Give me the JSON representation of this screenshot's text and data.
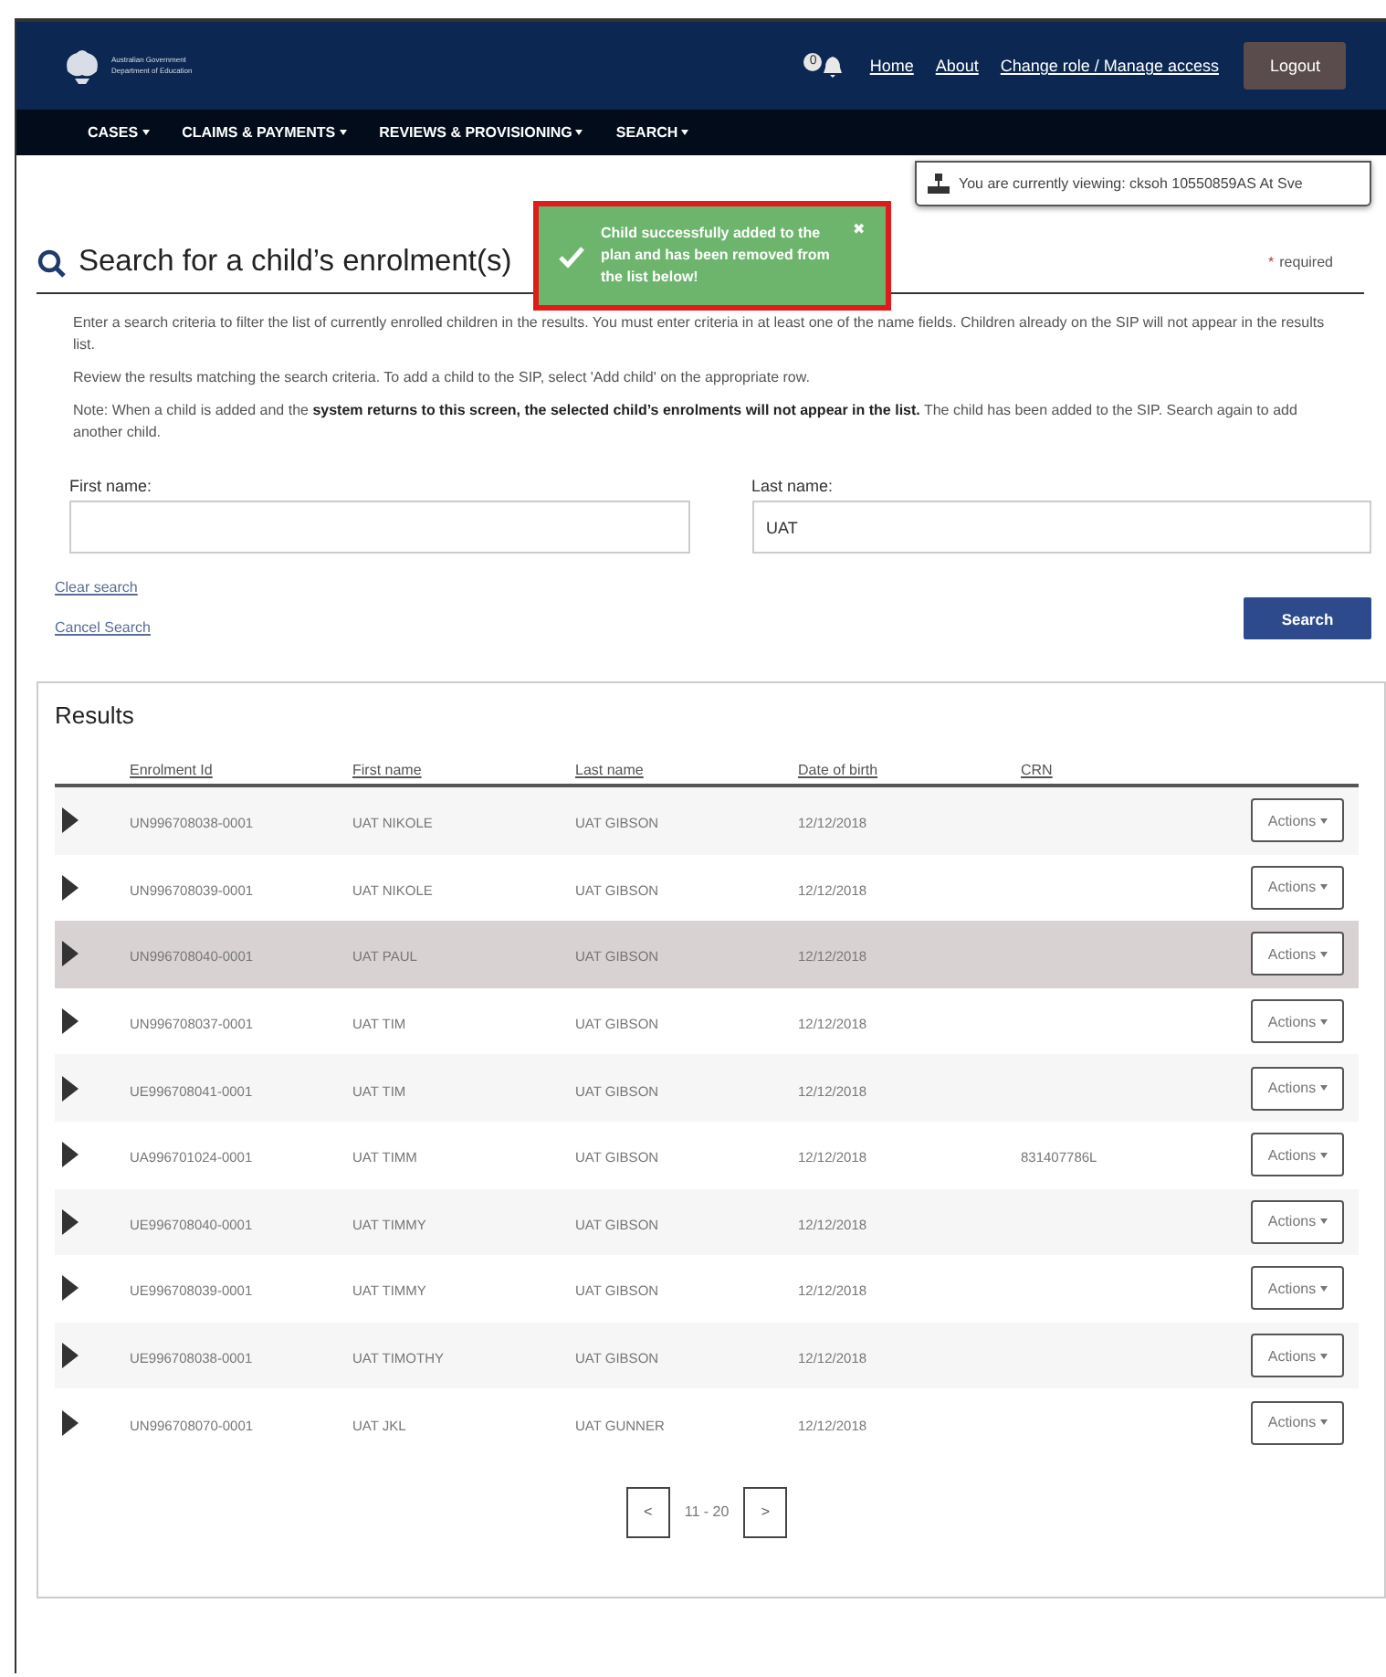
{
  "header": {
    "logo_lines": [
      "Australian Government",
      "Department of Education"
    ],
    "notification_count": "0",
    "links": [
      "Home",
      "About",
      "Change role / Manage access"
    ],
    "logout": "Logout"
  },
  "nav": {
    "items": [
      "CASES",
      "CLAIMS & PAYMENTS",
      "REVIEWS & PROVISIONING",
      "SEARCH"
    ]
  },
  "viewing_notice": "You are currently viewing: cksoh 10550859AS At Sve",
  "toast": {
    "message": "Child successfully added to the plan and has been removed from the list below!",
    "close": "✖"
  },
  "page": {
    "title": "Search for a child’s enrolment(s)",
    "required_mark": "*",
    "required_label": "required",
    "instructions": [
      "Enter a search criteria to filter the list of currently enrolled children in the results. You must enter criteria in at least one of the name fields. Children already on the SIP will not appear in the results list.",
      "Review the results matching the search criteria. To add a child to the SIP, select 'Add child' on the appropriate row.",
      "Note: When a child is added and the **system returns to this screen, the selected child’s enrolments will not appear in the list.** The child has been added to the SIP. Search again to add another child."
    ]
  },
  "form": {
    "fields": [
      {
        "label": "First name:"
      },
      {
        "label": "Last name:",
        "value": "UAT"
      }
    ],
    "clear_search": "Clear search",
    "cancel_search": "Cancel Search",
    "search_button": "Search"
  },
  "results": {
    "title": "Results",
    "columns": [
      "Enrolment Id",
      "First name",
      "Last name",
      "Date of birth",
      "CRN"
    ],
    "rows": [
      {
        "enrolment_id": "UN996708038-0001",
        "first_name": "UAT NIKOLE",
        "last_name": "UAT GIBSON",
        "date_of_birth": "12/12/2018",
        "selected": false,
        "action": "Actions"
      },
      {
        "enrolment_id": "UN996708039-0001",
        "first_name": "UAT NIKOLE",
        "last_name": "UAT GIBSON",
        "date_of_birth": "12/12/2018",
        "selected": false,
        "action": "Actions"
      },
      {
        "enrolment_id": "UN996708040-0001",
        "first_name": "UAT PAUL",
        "last_name": "UAT GIBSON",
        "date_of_birth": "12/12/2018",
        "selected": true,
        "action": "Actions"
      },
      {
        "enrolment_id": "UN996708037-0001",
        "first_name": "UAT TIM",
        "last_name": "UAT GIBSON",
        "date_of_birth": "12/12/2018",
        "selected": false,
        "action": "Actions"
      },
      {
        "enrolment_id": "UE996708041-0001",
        "first_name": "UAT TIM",
        "last_name": "UAT GIBSON",
        "date_of_birth": "12/12/2018",
        "selected": false,
        "action": "Actions"
      },
      {
        "enrolment_id": "UA996701024-0001",
        "first_name": "UAT TIMM",
        "last_name": "UAT GIBSON",
        "date_of_birth": "12/12/2018",
        "crn": "831407786L",
        "selected": false,
        "action": "Actions"
      },
      {
        "enrolment_id": "UE996708040-0001",
        "first_name": "UAT TIMMY",
        "last_name": "UAT GIBSON",
        "date_of_birth": "12/12/2018",
        "selected": false,
        "action": "Actions"
      },
      {
        "enrolment_id": "UE996708039-0001",
        "first_name": "UAT TIMMY",
        "last_name": "UAT GIBSON",
        "date_of_birth": "12/12/2018",
        "selected": false,
        "action": "Actions"
      },
      {
        "enrolment_id": "UE996708038-0001",
        "first_name": "UAT TIMOTHY",
        "last_name": "UAT GIBSON",
        "date_of_birth": "12/12/2018",
        "selected": false,
        "action": "Actions"
      },
      {
        "enrolment_id": "UN996708070-0001",
        "first_name": "UAT JKL",
        "last_name": "UAT GUNNER",
        "date_of_birth": "12/12/2018",
        "selected": false,
        "action": "Actions"
      }
    ],
    "pagination": {
      "prev": "<",
      "range": "11 - 20",
      "next": ">"
    }
  }
}
